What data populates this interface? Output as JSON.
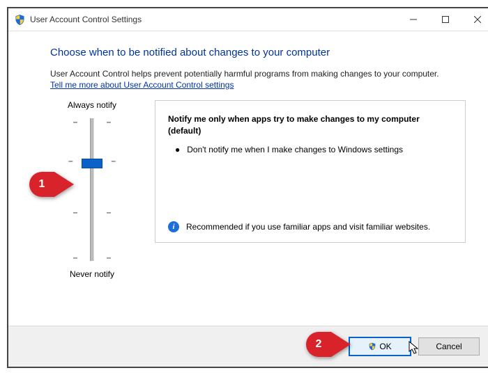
{
  "titlebar": {
    "title": "User Account Control Settings"
  },
  "content": {
    "heading": "Choose when to be notified about changes to your computer",
    "intro": "User Account Control helps prevent potentially harmful programs from making changes to your computer.",
    "link": "Tell me more about User Account Control settings",
    "slider": {
      "top_label": "Always notify",
      "bottom_label": "Never notify"
    },
    "description": {
      "title": "Notify me only when apps try to make changes to my computer (default)",
      "bullet": "Don't notify me when I make changes to Windows settings",
      "recommendation": "Recommended if you use familiar apps and visit familiar websites."
    }
  },
  "footer": {
    "ok_label": "OK",
    "cancel_label": "Cancel"
  },
  "callouts": {
    "one": "1",
    "two": "2"
  }
}
